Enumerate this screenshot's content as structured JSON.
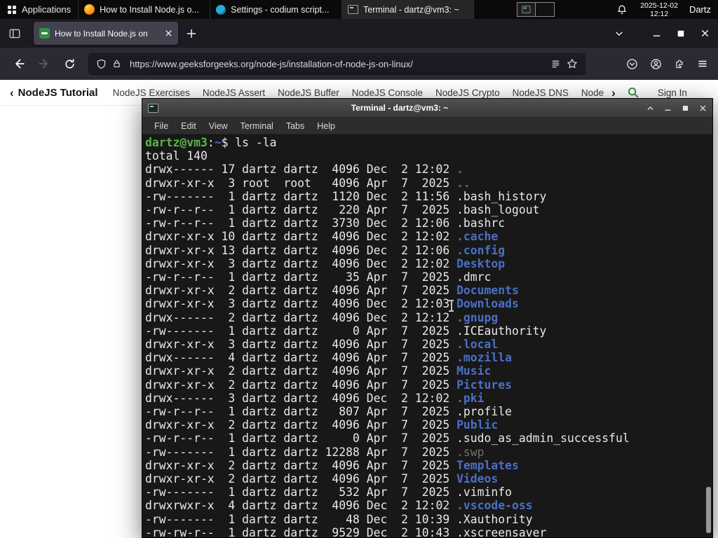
{
  "colors": {
    "panel_bg": "#0a0a0a",
    "firefox_tabbar_bg": "#1c1b22",
    "firefox_toolbar_bg": "#2b2a33",
    "firefox_active_tab_bg": "#42414d",
    "gfg_green": "#2f8d46",
    "terminal_bg": "#181818",
    "terminal_prompt_green": "#57b946",
    "terminal_dir_blue": "#4a6fc4",
    "terminal_dim_gray": "#707070"
  },
  "panel": {
    "applications_label": "Applications",
    "taskbar": [
      {
        "title": "How to Install Node.js o...",
        "icon": "firefox"
      },
      {
        "title": "Settings - codium script...",
        "icon": "codium"
      },
      {
        "title": "Terminal - dartz@vm3: ~",
        "icon": "terminal"
      }
    ],
    "clock": {
      "date": "2025-12-02",
      "time": "12:12"
    },
    "user": "Dartz"
  },
  "browser": {
    "tab": {
      "title": "How to Install Node.js on"
    },
    "url": "https://www.geeksforgeeks.org/node-js/installation-of-node-js-on-linux/",
    "site_nav": {
      "primary": "NodeJS Tutorial",
      "items": [
        "NodeJS Exercises",
        "NodeJS Assert",
        "NodeJS Buffer",
        "NodeJS Console",
        "NodeJS Crypto",
        "NodeJS DNS",
        "Node"
      ],
      "sign_in": "Sign In"
    }
  },
  "terminal": {
    "title": "Terminal - dartz@vm3: ~",
    "menu": [
      "File",
      "Edit",
      "View",
      "Terminal",
      "Tabs",
      "Help"
    ],
    "prompt": {
      "user_host": "dartz@vm3",
      "colon": ":",
      "cwd": "~",
      "dollar": "$",
      "command": " ls -la"
    },
    "total": "total 140",
    "ls": [
      {
        "pre": "drwx------ 17 dartz dartz  4096 Dec  2 12:02 ",
        "name": ".",
        "type": "dir"
      },
      {
        "pre": "drwxr-xr-x  3 root  root   4096 Apr  7  2025 ",
        "name": "..",
        "type": "dir"
      },
      {
        "pre": "-rw-------  1 dartz dartz  1120 Dec  2 11:56 ",
        "name": ".bash_history",
        "type": "file"
      },
      {
        "pre": "-rw-r--r--  1 dartz dartz   220 Apr  7  2025 ",
        "name": ".bash_logout",
        "type": "file"
      },
      {
        "pre": "-rw-r--r--  1 dartz dartz  3730 Dec  2 12:06 ",
        "name": ".bashrc",
        "type": "file"
      },
      {
        "pre": "drwxr-xr-x 10 dartz dartz  4096 Dec  2 12:02 ",
        "name": ".cache",
        "type": "dir"
      },
      {
        "pre": "drwxr-xr-x 13 dartz dartz  4096 Dec  2 12:06 ",
        "name": ".config",
        "type": "dir"
      },
      {
        "pre": "drwxr-xr-x  3 dartz dartz  4096 Dec  2 12:02 ",
        "name": "Desktop",
        "type": "dir"
      },
      {
        "pre": "-rw-r--r--  1 dartz dartz    35 Apr  7  2025 ",
        "name": ".dmrc",
        "type": "file"
      },
      {
        "pre": "drwxr-xr-x  2 dartz dartz  4096 Apr  7  2025 ",
        "name": "Documents",
        "type": "dir"
      },
      {
        "pre": "drwxr-xr-x  3 dartz dartz  4096 Dec  2 12:03 ",
        "name": "Downloads",
        "type": "dir"
      },
      {
        "pre": "drwx------  2 dartz dartz  4096 Dec  2 12:12 ",
        "name": ".gnupg",
        "type": "dir"
      },
      {
        "pre": "-rw-------  1 dartz dartz     0 Apr  7  2025 ",
        "name": ".ICEauthority",
        "type": "file"
      },
      {
        "pre": "drwxr-xr-x  3 dartz dartz  4096 Apr  7  2025 ",
        "name": ".local",
        "type": "dir"
      },
      {
        "pre": "drwx------  4 dartz dartz  4096 Apr  7  2025 ",
        "name": ".mozilla",
        "type": "dir"
      },
      {
        "pre": "drwxr-xr-x  2 dartz dartz  4096 Apr  7  2025 ",
        "name": "Music",
        "type": "dir"
      },
      {
        "pre": "drwxr-xr-x  2 dartz dartz  4096 Apr  7  2025 ",
        "name": "Pictures",
        "type": "dir"
      },
      {
        "pre": "drwx------  3 dartz dartz  4096 Dec  2 12:02 ",
        "name": ".pki",
        "type": "dir"
      },
      {
        "pre": "-rw-r--r--  1 dartz dartz   807 Apr  7  2025 ",
        "name": ".profile",
        "type": "file"
      },
      {
        "pre": "drwxr-xr-x  2 dartz dartz  4096 Apr  7  2025 ",
        "name": "Public",
        "type": "dir"
      },
      {
        "pre": "-rw-r--r--  1 dartz dartz     0 Apr  7  2025 ",
        "name": ".sudo_as_admin_successful",
        "type": "file"
      },
      {
        "pre": "-rw-------  1 dartz dartz 12288 Apr  7  2025 ",
        "name": ".swp",
        "type": "dim"
      },
      {
        "pre": "drwxr-xr-x  2 dartz dartz  4096 Apr  7  2025 ",
        "name": "Templates",
        "type": "dir"
      },
      {
        "pre": "drwxr-xr-x  2 dartz dartz  4096 Apr  7  2025 ",
        "name": "Videos",
        "type": "dir"
      },
      {
        "pre": "-rw-------  1 dartz dartz   532 Apr  7  2025 ",
        "name": ".viminfo",
        "type": "file"
      },
      {
        "pre": "drwxrwxr-x  4 dartz dartz  4096 Dec  2 12:02 ",
        "name": ".vscode-oss",
        "type": "dir"
      },
      {
        "pre": "-rw-------  1 dartz dartz    48 Dec  2 10:39 ",
        "name": ".Xauthority",
        "type": "file"
      },
      {
        "pre": "-rw-rw-r--  1 dartz dartz  9529 Dec  2 10:43 ",
        "name": ".xscreensaver",
        "type": "file"
      }
    ]
  }
}
